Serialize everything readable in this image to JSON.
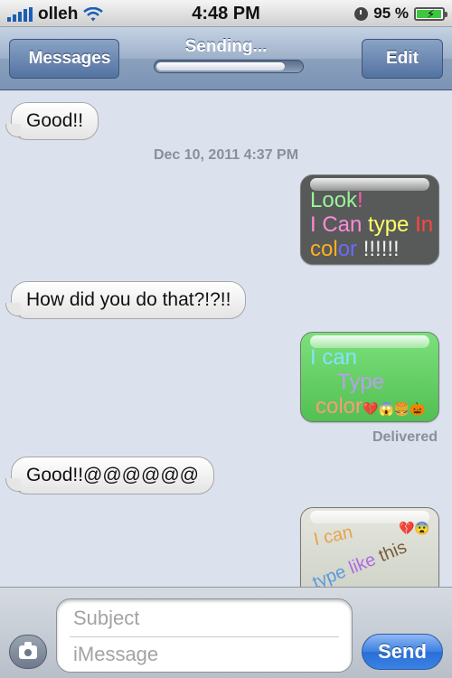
{
  "status_bar": {
    "carrier": "olleh",
    "time": "4:48 PM",
    "battery_percent": "95 %",
    "battery_level": 0.95
  },
  "nav": {
    "back_label": "Messages",
    "title": "Sending...",
    "progress": 0.9,
    "edit_label": "Edit"
  },
  "messages": [
    {
      "kind": "received",
      "text": "Good!!"
    },
    {
      "kind": "timestamp",
      "text": "Dec 10, 2011 4:37 PM"
    },
    {
      "kind": "sent-image",
      "lines": [
        [
          {
            "t": "Look",
            "c": "#9cf29c"
          },
          {
            "t": "!",
            "c": "#ff5aa8"
          }
        ],
        [
          {
            "t": "I Can ",
            "c": "#ff8ad8"
          },
          {
            "t": "type ",
            "c": "#ffff66"
          },
          {
            "t": "In",
            "c": "#ff4444"
          }
        ],
        [
          {
            "t": "col",
            "c": "#ffb020"
          },
          {
            "t": "or ",
            "c": "#6a6aff"
          },
          {
            "t": "!!!!!!",
            "c": "#f0f0f0"
          }
        ]
      ]
    },
    {
      "kind": "received",
      "text": "How did you do that?!?!!"
    },
    {
      "kind": "sent-image",
      "lines": [
        [
          {
            "t": "I can",
            "c": "#80e4ff"
          }
        ],
        [
          {
            "t": "Type",
            "c": "#b89ff0"
          }
        ],
        [
          {
            "t": "color",
            "c": "#ff9a7a"
          },
          {
            "t": "💔😱🍔🎃",
            "c": "#000"
          }
        ]
      ]
    },
    {
      "kind": "status",
      "text": "Delivered"
    },
    {
      "kind": "received",
      "text": "Good!!@@@@@@"
    },
    {
      "kind": "sent-image",
      "lines": [
        [
          {
            "t": "I can",
            "c": "#e8a24a"
          }
        ],
        [
          {
            "t": "type",
            "c": "#5a9ae0"
          },
          {
            "t": " like",
            "c": "#b06adf"
          },
          {
            "t": " this",
            "c": "#7a5a3a"
          }
        ]
      ],
      "emoji": "💔😨"
    }
  ],
  "compose": {
    "subject_placeholder": "Subject",
    "message_placeholder": "iMessage",
    "send_label": "Send"
  },
  "colors": {
    "nav_blue": "#7b93b4",
    "send_blue": "#3d7fe0",
    "thread_bg": "#dbe2ed"
  }
}
